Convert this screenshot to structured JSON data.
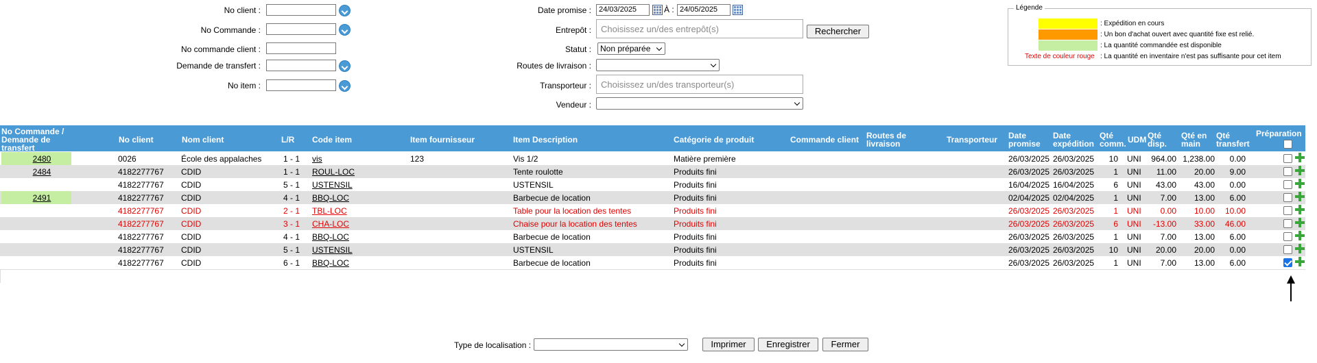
{
  "filters": {
    "no_client_label": "No client :",
    "no_commande_label": "No Commande :",
    "no_commande_client_label": "No commande client :",
    "demande_transfert_label": "Demande de transfert :",
    "no_item_label": "No item :",
    "date_promise_label": "Date promise :",
    "date_from": "24/03/2025",
    "date_to_label": "À :",
    "date_to": "24/05/2025",
    "entrepot_label": "Entrepôt :",
    "entrepot_placeholder": "Choisissez un/des entrepôt(s)",
    "rechercher": "Rechercher",
    "statut_label": "Statut :",
    "statut_value": "Non préparée",
    "routes_label": "Routes de livraison :",
    "transporteur_label": "Transporteur :",
    "transporteur_placeholder": "Choisissez un/des transporteur(s)",
    "vendeur_label": "Vendeur :"
  },
  "legend": {
    "title": "Légende",
    "yellow_color": "#ffff00",
    "orange_color": "#ff9900",
    "green_color": "#c6eea3",
    "yellow_text": ": Expédition en cours",
    "orange_text": ": Un bon d'achat ouvert avec quantité fixe est relié.",
    "green_text": ": La quantité commandée est disponible",
    "red_label": "Texte de couleur rouge",
    "red_text": ": La quantité en inventaire n'est pas suffisante pour cet item"
  },
  "table": {
    "headers": {
      "no_commande_1": "No Commande /",
      "no_commande_2": "Demande de",
      "no_commande_3": "transfert",
      "no_client": "No client",
      "nom_client": "Nom client",
      "lr": "L/R",
      "code_item": "Code item",
      "item_fournisseur": "Item fournisseur",
      "item_description": "Item Description",
      "categorie": "Catégorie de produit",
      "commande_client": "Commande client",
      "routes_1": "Routes de",
      "routes_2": "livraison",
      "transporteur": "Transporteur",
      "date_promise_1": "Date",
      "date_promise_2": "promise",
      "date_exp_1": "Date",
      "date_exp_2": "expédition",
      "qte_comm_1": "Qté",
      "qte_comm_2": "comm.",
      "udm": "UDM",
      "qte_disp_1": "Qté",
      "qte_disp_2": "disp.",
      "qte_main_1": "Qté en",
      "qte_main_2": "main",
      "qte_transfert_1": "Qté",
      "qte_transfert_2": "transfert",
      "preparation": "Préparation"
    },
    "rows": [
      {
        "order": "2480",
        "client": "0026",
        "nom": "École des appalaches",
        "lr": "1 - 1",
        "code": "vis",
        "fourn": "123",
        "desc": "Vis 1/2",
        "cat": "Matière première",
        "dprom": "26/03/2025",
        "dexp": "26/03/2025",
        "qcomm": "10",
        "udm": "UNI",
        "qdisp": "964.00",
        "qmain": "1,238.00",
        "qtrans": "0.00",
        "checked": false
      },
      {
        "order": "2484",
        "client": "4182277767",
        "nom": "CDID",
        "lr": "1 - 1",
        "code": "ROUL-LOC",
        "fourn": "",
        "desc": "Tente roulotte",
        "cat": "Produits fini",
        "dprom": "26/03/2025",
        "dexp": "26/03/2025",
        "qcomm": "1",
        "udm": "UNI",
        "qdisp": "11.00",
        "qmain": "20.00",
        "qtrans": "9.00",
        "checked": false
      },
      {
        "order": "",
        "client": "4182277767",
        "nom": "CDID",
        "lr": "5 - 1",
        "code": "USTENSIL",
        "fourn": "",
        "desc": "USTENSIL",
        "cat": "Produits fini",
        "dprom": "16/04/2025",
        "dexp": "16/04/2025",
        "qcomm": "6",
        "udm": "UNI",
        "qdisp": "43.00",
        "qmain": "43.00",
        "qtrans": "0.00",
        "checked": false
      },
      {
        "order": "2491",
        "client": "4182277767",
        "nom": "CDID",
        "lr": "4 - 1",
        "code": "BBQ-LOC",
        "fourn": "",
        "desc": "Barbecue de location",
        "cat": "Produits fini",
        "dprom": "02/04/2025",
        "dexp": "02/04/2025",
        "qcomm": "1",
        "udm": "UNI",
        "qdisp": "7.00",
        "qmain": "13.00",
        "qtrans": "6.00",
        "checked": false
      },
      {
        "order": "",
        "client": "4182277767",
        "nom": "CDID",
        "lr": "2 - 1",
        "code": "TBL-LOC",
        "fourn": "",
        "desc": "Table pour la location des tentes",
        "cat": "Produits fini",
        "dprom": "26/03/2025",
        "dexp": "26/03/2025",
        "qcomm": "1",
        "udm": "UNI",
        "qdisp": "0.00",
        "qmain": "10.00",
        "qtrans": "10.00",
        "checked": false
      },
      {
        "order": "",
        "client": "4182277767",
        "nom": "CDID",
        "lr": "3 - 1",
        "code": "CHA-LOC",
        "fourn": "",
        "desc": "Chaise pour la location des tentes",
        "cat": "Produits fini",
        "dprom": "26/03/2025",
        "dexp": "26/03/2025",
        "qcomm": "6",
        "udm": "UNI",
        "qdisp": "-13.00",
        "qmain": "33.00",
        "qtrans": "46.00",
        "checked": false
      },
      {
        "order": "",
        "client": "4182277767",
        "nom": "CDID",
        "lr": "4 - 1",
        "code": "BBQ-LOC",
        "fourn": "",
        "desc": "Barbecue de location",
        "cat": "Produits fini",
        "dprom": "26/03/2025",
        "dexp": "26/03/2025",
        "qcomm": "1",
        "udm": "UNI",
        "qdisp": "7.00",
        "qmain": "13.00",
        "qtrans": "6.00",
        "checked": false
      },
      {
        "order": "",
        "client": "4182277767",
        "nom": "CDID",
        "lr": "5 - 1",
        "code": "USTENSIL",
        "fourn": "",
        "desc": "USTENSIL",
        "cat": "Produits fini",
        "dprom": "26/03/2025",
        "dexp": "26/03/2025",
        "qcomm": "10",
        "udm": "UNI",
        "qdisp": "20.00",
        "qmain": "20.00",
        "qtrans": "0.00",
        "checked": false
      },
      {
        "order": "",
        "client": "4182277767",
        "nom": "CDID",
        "lr": "6 - 1",
        "code": "BBQ-LOC",
        "fourn": "",
        "desc": "Barbecue de location",
        "cat": "Produits fini",
        "dprom": "26/03/2025",
        "dexp": "26/03/2025",
        "qcomm": "1",
        "udm": "UNI",
        "qdisp": "7.00",
        "qmain": "13.00",
        "qtrans": "6.00",
        "checked": true
      }
    ]
  },
  "footer": {
    "type_localisation_label": "Type de localisation :",
    "imprimer": "Imprimer",
    "enregistrer": "Enregistrer",
    "fermer": "Fermer"
  }
}
